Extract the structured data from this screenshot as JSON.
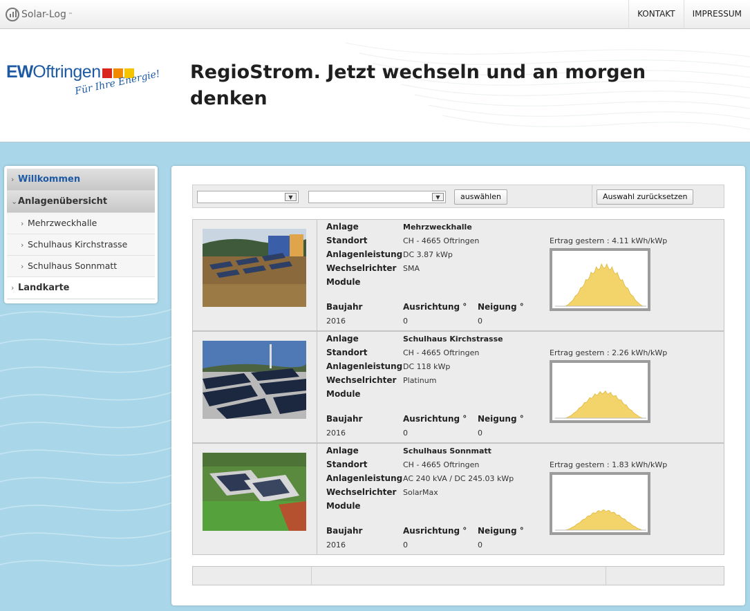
{
  "brand": {
    "name": "Solar-Log",
    "trademark": "™"
  },
  "topnav": {
    "contact": "KONTAKT",
    "imprint": "IMPRESSUM"
  },
  "logo": {
    "ew": "EW",
    "name": "Oftringen",
    "slogan": "Für Ihre Energie!",
    "square_colors": [
      "#d9261c",
      "#f08a00",
      "#f5c400"
    ]
  },
  "headline": "RegioStrom. Jetzt wechseln und an morgen denken",
  "sidebar": {
    "welcome": "Willkommen",
    "overview": "Anlagenübersicht",
    "items": [
      "Mehrzweckhalle",
      "Schulhaus Kirchstrasse",
      "Schulhaus Sonnmatt"
    ],
    "map": "Landkarte"
  },
  "toolbar": {
    "select_label": "auswählen",
    "reset_label": "Auswahl zurücksetzen"
  },
  "labels": {
    "plant": "Anlage",
    "location": "Standort",
    "power": "Anlagenleistung",
    "inverter": "Wechselrichter",
    "modules": "Module",
    "year": "Baujahr",
    "orientation": "Ausrichtung °",
    "tilt": "Neigung °"
  },
  "plants": [
    {
      "name": "Mehrzweckhalle",
      "location": "CH - 4665 Oftringen",
      "power": "DC 3.87 kWp",
      "inverter": "SMA",
      "modules": "",
      "year": "2016",
      "orientation": "0",
      "tilt": "0",
      "yield": "Ertrag gestern : 4.11 kWh/kWp",
      "curve_peak": 0.85,
      "photo": "green-roof-solar"
    },
    {
      "name": "Schulhaus Kirchstrasse",
      "location": "CH - 4665 Oftringen",
      "power": "DC 118 kWp",
      "inverter": "Platinum",
      "modules": "",
      "year": "2016",
      "orientation": "0",
      "tilt": "0",
      "yield": "Ertrag gestern : 2.26 kWh/kWp",
      "curve_peak": 0.55,
      "photo": "flat-roof-panels"
    },
    {
      "name": "Schulhaus Sonnmatt",
      "location": "CH - 4665 Oftringen",
      "power": "AC 240 kVA / DC 245.03 kWp",
      "inverter": "SolarMax",
      "modules": "",
      "year": "2016",
      "orientation": "0",
      "tilt": "0",
      "yield": "Ertrag gestern : 1.83 kWh/kWp",
      "curve_peak": 0.42,
      "photo": "school-aerial"
    }
  ],
  "colors": {
    "accent": "#1d5aa3",
    "curve_fill": "#f3d46a",
    "curve_stroke": "#e0b63a"
  }
}
